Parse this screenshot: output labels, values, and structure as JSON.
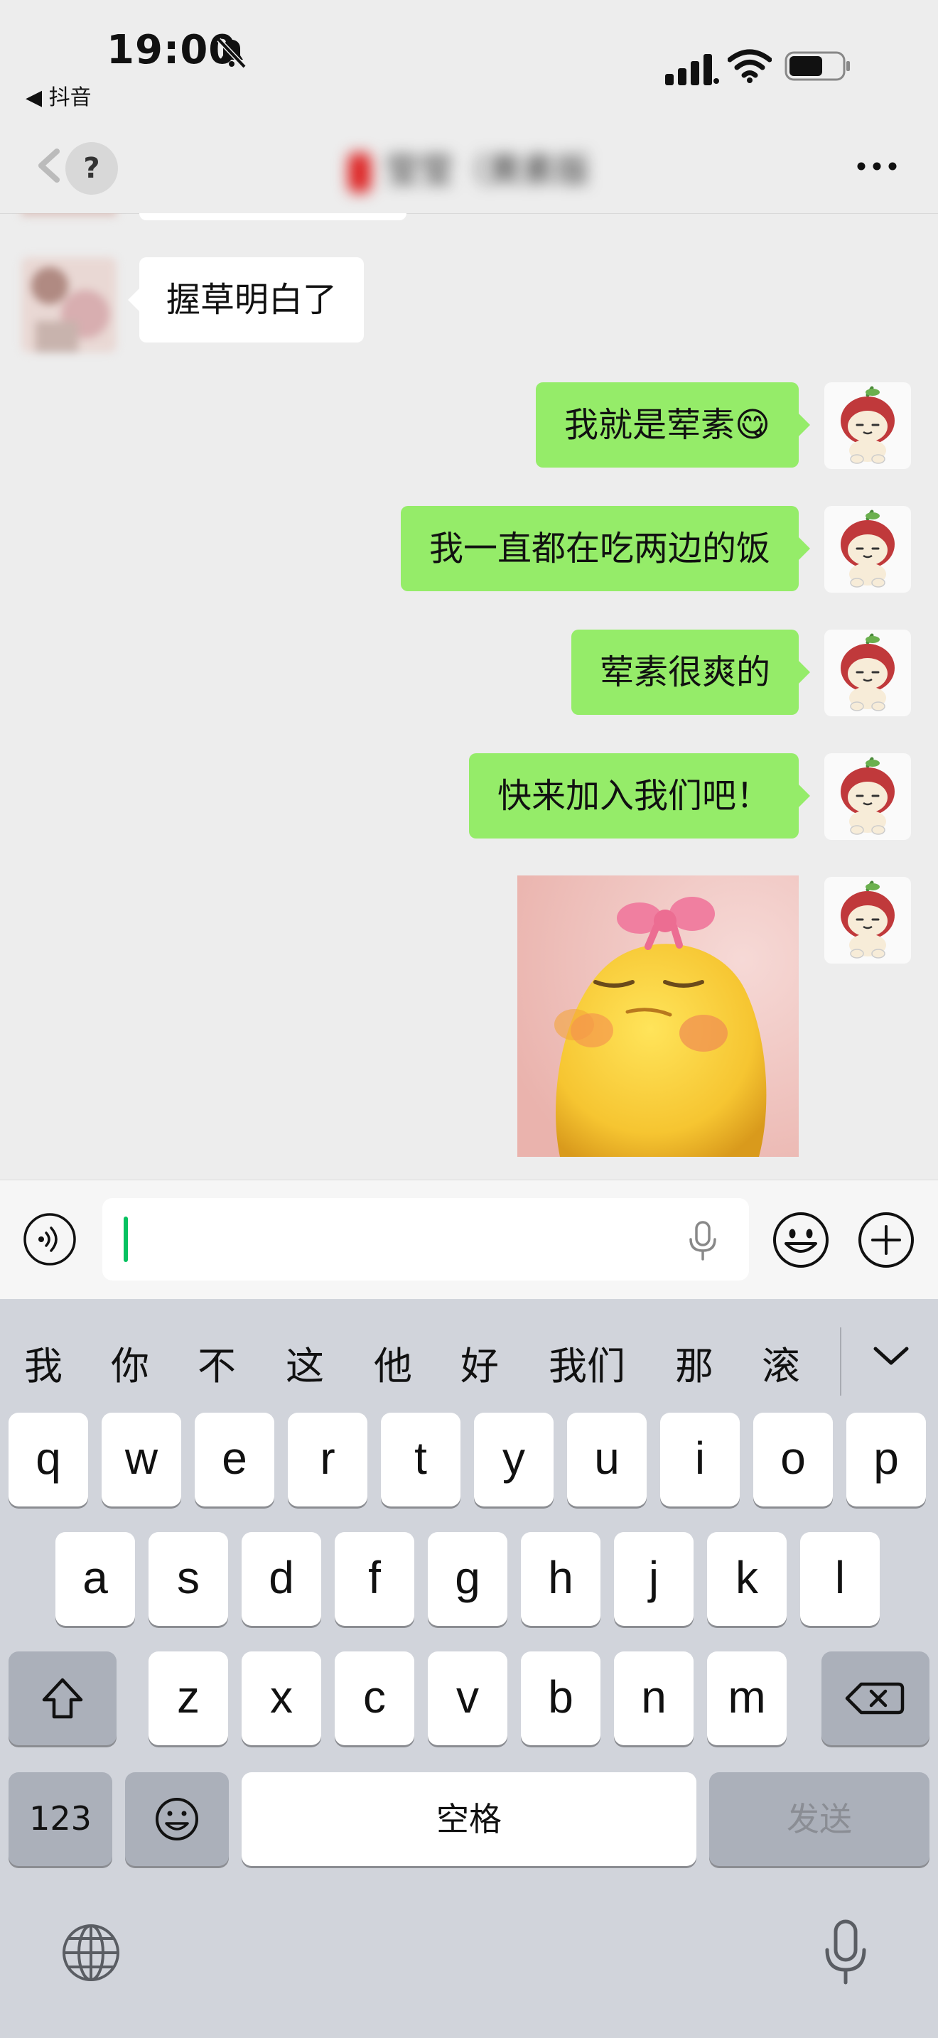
{
  "status_bar": {
    "time": "19:00",
    "back_app": "◀ 抖音"
  },
  "nav": {
    "help_glyph": "?",
    "title": "莹莹（黄素版"
  },
  "messages": [
    {
      "side": "in",
      "text": "握草明白了"
    },
    {
      "side": "out",
      "text": "我就是荤素😋"
    },
    {
      "side": "out",
      "text": "我一直都在吃两边的饭"
    },
    {
      "side": "out",
      "text": "荤素很爽的"
    },
    {
      "side": "out",
      "text": "快来加入我们吧！"
    },
    {
      "side": "out",
      "type": "sticker",
      "description_icon": "yellow-chick-sticker"
    }
  ],
  "input": {
    "value": ""
  },
  "keyboard": {
    "suggestions": [
      "我",
      "你",
      "不",
      "这",
      "他",
      "好",
      "我们",
      "那",
      "滚"
    ],
    "row1": [
      "q",
      "w",
      "e",
      "r",
      "t",
      "y",
      "u",
      "i",
      "o",
      "p"
    ],
    "row2": [
      "a",
      "s",
      "d",
      "f",
      "g",
      "h",
      "j",
      "k",
      "l"
    ],
    "row3": [
      "z",
      "x",
      "c",
      "v",
      "b",
      "n",
      "m"
    ],
    "numbers_label": "123",
    "space_label": "空格",
    "send_label": "发送"
  },
  "colors": {
    "outgoing_bubble": "#95ec69",
    "incoming_bubble": "#ffffff",
    "caret": "#07c160",
    "background": "#ededed"
  }
}
